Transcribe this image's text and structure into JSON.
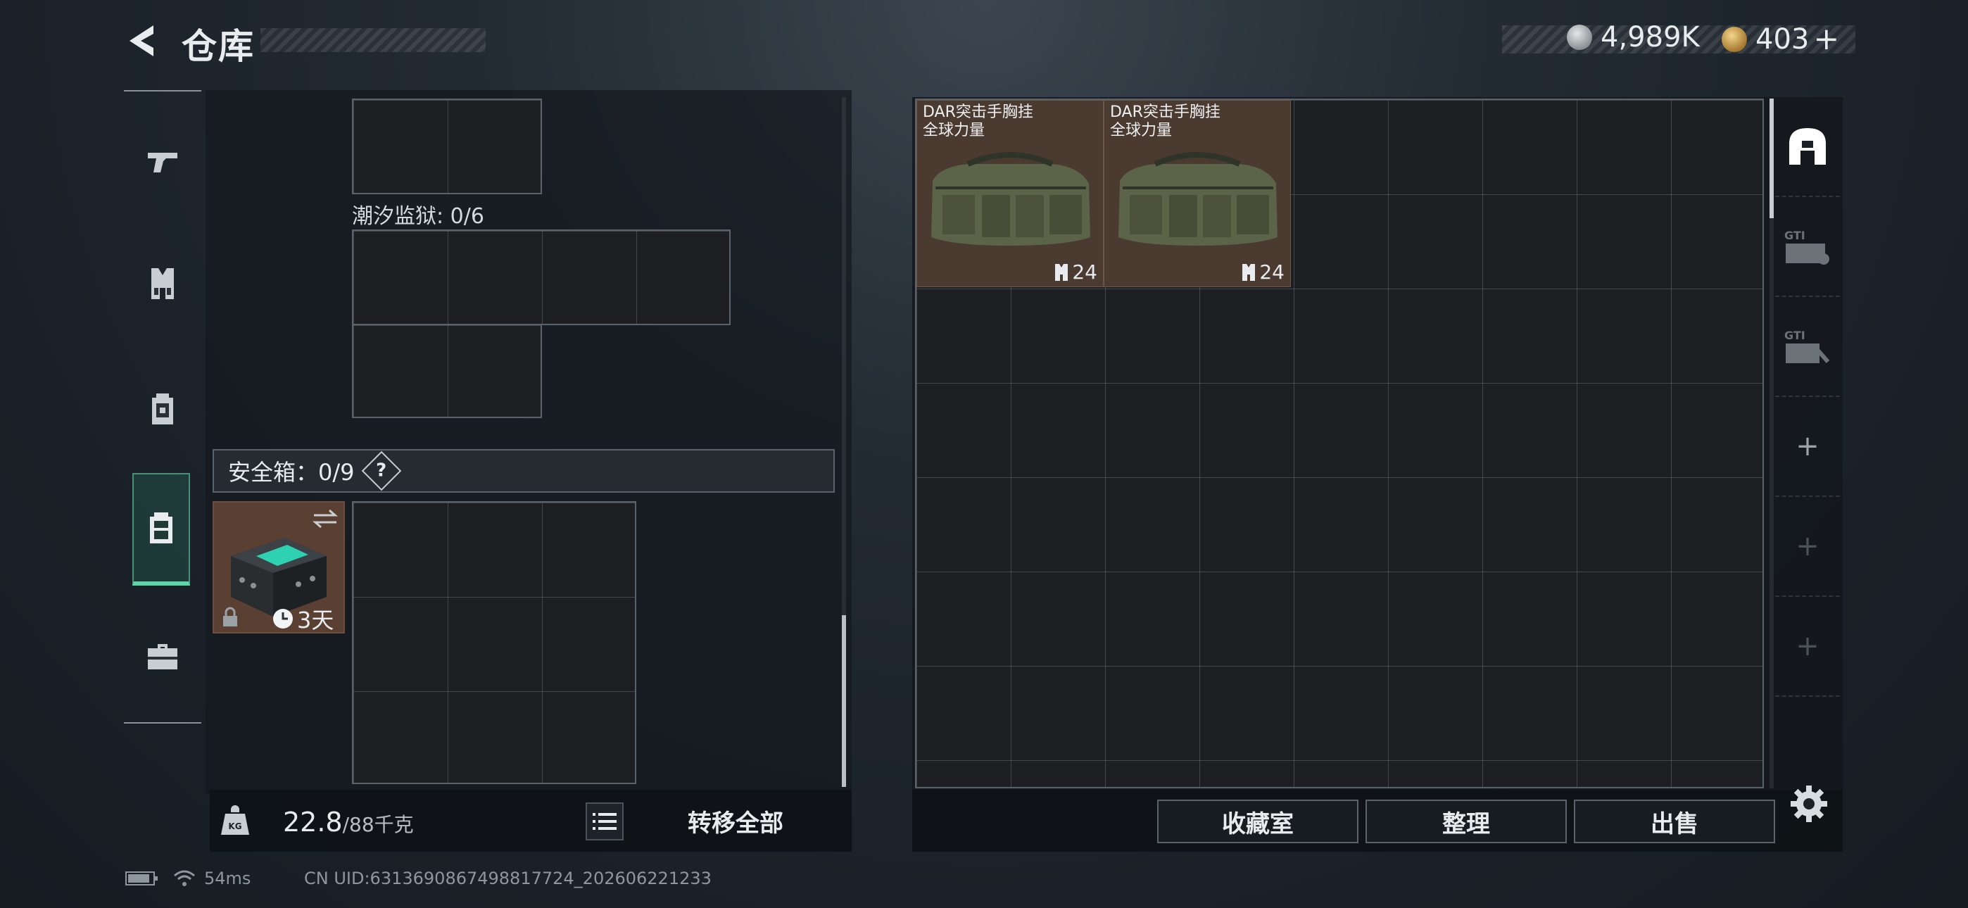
{
  "header": {
    "title": "仓库",
    "currency_silver": "4,989K",
    "currency_gold": "403",
    "currency_add": "+"
  },
  "nav": {
    "items": [
      {
        "name": "weapons",
        "icon": "pistol-icon"
      },
      {
        "name": "vest",
        "icon": "vest-icon"
      },
      {
        "name": "backpack",
        "icon": "backpack-icon"
      },
      {
        "name": "container",
        "icon": "pouch-icon",
        "active": true
      },
      {
        "name": "tools",
        "icon": "toolbox-icon"
      }
    ]
  },
  "left": {
    "section_tide_prison": "潮汐监狱: 0/6",
    "safe_box_label": "安全箱：0/9",
    "safe_box_help": "?",
    "safe_item_timer": "3天",
    "weight_current": "22.8",
    "weight_max": "/88千克",
    "transfer_all": "转移全部"
  },
  "right": {
    "items": [
      {
        "name_line1": "DAR突击手胸挂",
        "name_line2": "全球力量",
        "count": "24"
      },
      {
        "name_line1": "DAR突击手胸挂",
        "name_line2": "全球力量",
        "count": "24"
      }
    ],
    "side_tabs": [
      "home-tab",
      "gti-case-tab",
      "gti-lock-tab",
      "add-tab",
      "add-tab",
      "add-tab"
    ],
    "btn_collection": "收藏室",
    "btn_organize": "整理",
    "btn_sell": "出售"
  },
  "footer": {
    "ping": "54ms",
    "uid": "CN UID:6313690867498817724_202606221233"
  },
  "colors": {
    "accent_green": "#5fd6a8",
    "item_bg": "#4a3a30"
  }
}
